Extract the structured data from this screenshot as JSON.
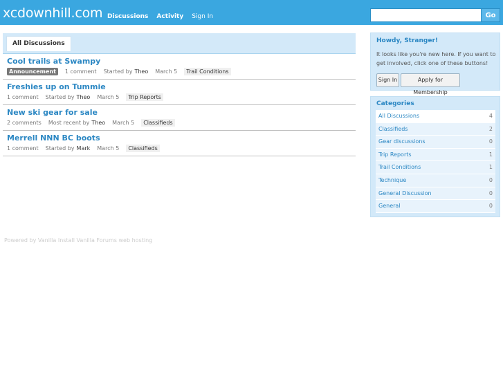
{
  "header": {
    "logo": "xcdownhill.com",
    "nav": [
      {
        "label": "Discussions"
      },
      {
        "label": "Activity"
      },
      {
        "label": "Sign In"
      }
    ],
    "search": {
      "placeholder": "",
      "button_label": "Go"
    }
  },
  "main": {
    "tab_label": "All Discussions",
    "discussions": [
      {
        "title": "Cool trails at Swampy",
        "badge": "Announcement",
        "comments": "1 comment",
        "started_label": "Started by",
        "author": "Theo",
        "date": "March 5",
        "category": "Trail Conditions"
      },
      {
        "title": "Freshies up on Tummie",
        "comments": "1 comment",
        "started_label": "Started by",
        "author": "Theo",
        "date": "March 5",
        "category": "Trip Reports"
      },
      {
        "title": "New ski gear for sale",
        "comments": "2 comments",
        "started_label": "Most recent by",
        "author": "Theo",
        "date": "March 5",
        "category": "Classifieds"
      },
      {
        "title": "Merrell NNN BC boots",
        "comments": "1 comment",
        "started_label": "Started by",
        "author": "Mark",
        "date": "March 5",
        "category": "Classifieds"
      }
    ]
  },
  "footer": {
    "text": "Powered by Vanilla Install Vanilla Forums web hosting"
  },
  "sidebar": {
    "howdy": {
      "title": "Howdy, Stranger!",
      "text": "It looks like you're new here. If you want to get involved, click one of these buttons!",
      "sign_in_label": "Sign In",
      "apply_label": "Apply for Membership"
    },
    "categories": {
      "title": "Categories",
      "items": [
        {
          "name": "All Discussions",
          "count": "4"
        },
        {
          "name": "Classifieds",
          "count": "2"
        },
        {
          "name": "Gear discussions",
          "count": "0"
        },
        {
          "name": "Trip Reports",
          "count": "1"
        },
        {
          "name": "Trail Conditions",
          "count": "1"
        },
        {
          "name": "Technique",
          "count": "0"
        },
        {
          "name": "General Discussion",
          "count": "0"
        },
        {
          "name": "General",
          "count": "0"
        }
      ]
    }
  }
}
